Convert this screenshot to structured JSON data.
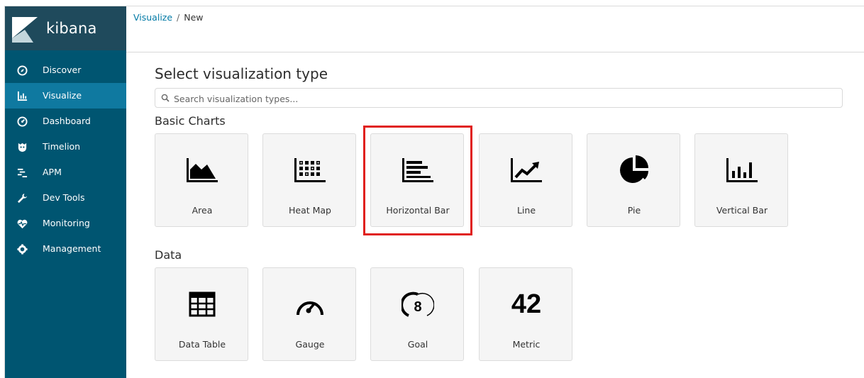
{
  "brand": {
    "name": "kibana"
  },
  "nav": [
    {
      "label": "Discover",
      "icon": "compass-icon"
    },
    {
      "label": "Visualize",
      "icon": "bar-chart-icon",
      "active": true
    },
    {
      "label": "Dashboard",
      "icon": "dashboard-icon"
    },
    {
      "label": "Timelion",
      "icon": "timelion-icon"
    },
    {
      "label": "APM",
      "icon": "apm-icon"
    },
    {
      "label": "Dev Tools",
      "icon": "wrench-icon"
    },
    {
      "label": "Monitoring",
      "icon": "heartbeat-icon"
    },
    {
      "label": "Management",
      "icon": "gear-icon"
    }
  ],
  "breadcrumb": {
    "parent": "Visualize",
    "separator": "/",
    "current": "New"
  },
  "main": {
    "title": "Select visualization type",
    "search_placeholder": "Search visualization types..."
  },
  "sections": [
    {
      "title": "Basic Charts",
      "cards": [
        {
          "label": "Area",
          "icon": "area-chart-icon"
        },
        {
          "label": "Heat Map",
          "icon": "heat-map-icon"
        },
        {
          "label": "Horizontal Bar",
          "icon": "horizontal-bar-icon",
          "highlighted": true
        },
        {
          "label": "Line",
          "icon": "line-chart-icon"
        },
        {
          "label": "Pie",
          "icon": "pie-chart-icon"
        },
        {
          "label": "Vertical Bar",
          "icon": "vertical-bar-icon"
        }
      ]
    },
    {
      "title": "Data",
      "cards": [
        {
          "label": "Data Table",
          "icon": "table-icon"
        },
        {
          "label": "Gauge",
          "icon": "gauge-icon"
        },
        {
          "label": "Goal",
          "icon": "goal-icon",
          "icon_text": "8"
        },
        {
          "label": "Metric",
          "icon": "metric-icon",
          "icon_text": "42"
        }
      ]
    }
  ],
  "colors": {
    "sidebar": "#005571",
    "sidebar_active": "#0f79a0",
    "link": "#0079a5",
    "highlight": "#e0201d"
  }
}
